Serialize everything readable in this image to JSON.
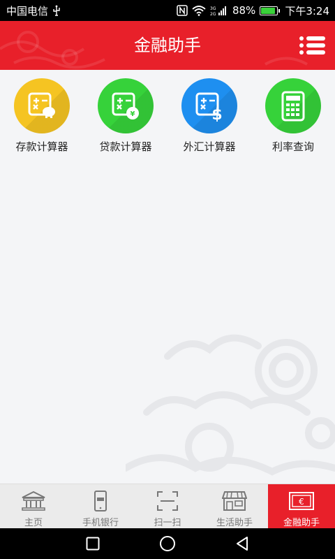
{
  "status_bar": {
    "carrier": "中国电信",
    "battery_percent": "88%",
    "battery_level": 0.88,
    "time": "下午3:24",
    "icons": [
      "usb-icon",
      "nfc-icon",
      "wifi-icon",
      "signal-icon",
      "battery-icon"
    ]
  },
  "header": {
    "title": "金融助手",
    "background_color": "#e8202a",
    "menu_icon": "list-menu-icon"
  },
  "tools": [
    {
      "label": "存款计算器",
      "color": "#f5c422",
      "icon": "deposit-calculator-icon"
    },
    {
      "label": "贷款计算器",
      "color": "#36d23a",
      "icon": "loan-calculator-icon"
    },
    {
      "label": "外汇计算器",
      "color": "#1e8ff0",
      "icon": "forex-calculator-icon"
    },
    {
      "label": "利率查询",
      "color": "#36d23a",
      "icon": "interest-rate-calculator-icon"
    }
  ],
  "tabbar": {
    "items": [
      {
        "label": "主页",
        "icon": "bank-building-icon",
        "active": false
      },
      {
        "label": "手机银行",
        "icon": "mobile-phone-icon",
        "active": false
      },
      {
        "label": "扫一扫",
        "icon": "scan-icon",
        "active": false
      },
      {
        "label": "生活助手",
        "icon": "store-icon",
        "active": false
      },
      {
        "label": "金融助手",
        "icon": "finance-card-icon",
        "active": true
      }
    ],
    "active_color": "#e8202a"
  },
  "navbar": {
    "buttons": [
      "recent-apps-icon",
      "home-icon",
      "back-icon"
    ]
  }
}
